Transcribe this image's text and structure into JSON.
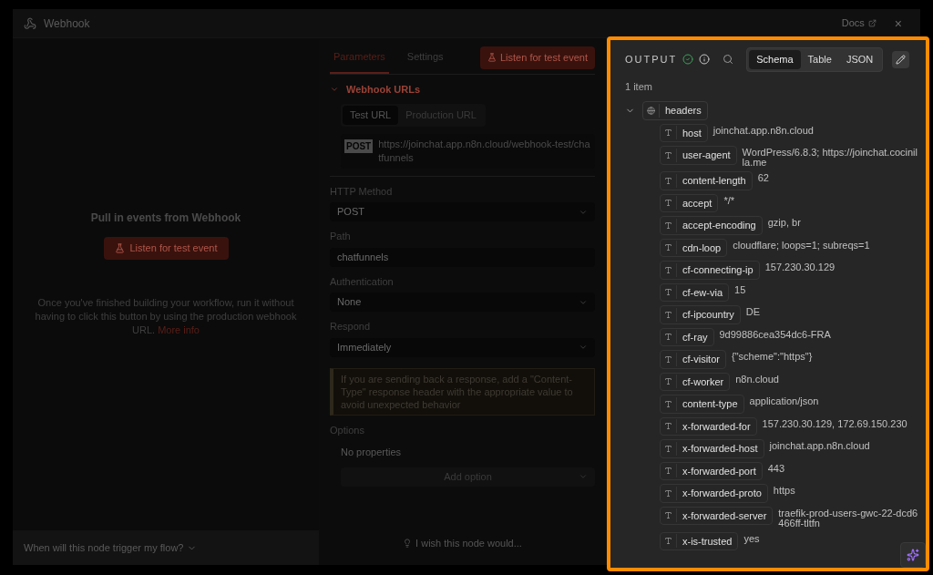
{
  "modal": {
    "title": "Webhook",
    "docs_link": "Docs",
    "close": "×"
  },
  "trigger_panel": {
    "heading": "Pull in events from Webhook",
    "listen_button": "Listen for test event",
    "description": "Once you've finished building your workflow, run it without having to click this button by using the production webhook URL.",
    "more_info_link": "More info",
    "footer": "When will this node trigger my flow?"
  },
  "parameters": {
    "tabs": [
      {
        "label": "Parameters",
        "selected": true
      },
      {
        "label": "Settings",
        "selected": false
      }
    ],
    "listen_button": "Listen for test event",
    "webhook_urls": {
      "title": "Webhook URLs",
      "expanded": true,
      "url_tabs": [
        {
          "label": "Test URL",
          "selected": true
        },
        {
          "label": "Production URL",
          "selected": false
        }
      ],
      "method_badge": "POST",
      "url": "https://joinchat.app.n8n.cloud/webhook-test/chatfunnels"
    },
    "fields": [
      {
        "label": "HTTP Method",
        "value": "POST",
        "kind": "select"
      },
      {
        "label": "Path",
        "value": "chatfunnels",
        "kind": "text"
      },
      {
        "label": "Authentication",
        "value": "None",
        "kind": "select"
      },
      {
        "label": "Respond",
        "value": "Immediately",
        "kind": "select"
      }
    ],
    "notice": "If you are sending back a response, add a \"Content-Type\" response header with the appropriate value to avoid unexpected behavior",
    "options": {
      "label": "Options",
      "empty_text": "No properties",
      "add_button": "Add option"
    },
    "feedback": "I wish this node would..."
  },
  "output": {
    "title": "OUTPUT",
    "view_tabs": [
      {
        "label": "Schema",
        "selected": true
      },
      {
        "label": "Table",
        "selected": false
      },
      {
        "label": "JSON",
        "selected": false
      }
    ],
    "count": "1 item",
    "tree": {
      "name": "headers",
      "expanded": true,
      "children": [
        {
          "key": "host",
          "value": "joinchat.app.n8n.cloud"
        },
        {
          "key": "user-agent",
          "value": "WordPress/6.8.3; https://joinchat.cocinilla.me"
        },
        {
          "key": "content-length",
          "value": "62"
        },
        {
          "key": "accept",
          "value": "*/*"
        },
        {
          "key": "accept-encoding",
          "value": "gzip, br"
        },
        {
          "key": "cdn-loop",
          "value": "cloudflare; loops=1; subreqs=1"
        },
        {
          "key": "cf-connecting-ip",
          "value": "157.230.30.129"
        },
        {
          "key": "cf-ew-via",
          "value": "15"
        },
        {
          "key": "cf-ipcountry",
          "value": "DE"
        },
        {
          "key": "cf-ray",
          "value": "9d99886cea354dc6-FRA"
        },
        {
          "key": "cf-visitor",
          "value": "{\"scheme\":\"https\"}"
        },
        {
          "key": "cf-worker",
          "value": "n8n.cloud"
        },
        {
          "key": "content-type",
          "value": "application/json"
        },
        {
          "key": "x-forwarded-for",
          "value": "157.230.30.129, 172.69.150.230"
        },
        {
          "key": "x-forwarded-host",
          "value": "joinchat.app.n8n.cloud"
        },
        {
          "key": "x-forwarded-port",
          "value": "443"
        },
        {
          "key": "x-forwarded-proto",
          "value": "https"
        },
        {
          "key": "x-forwarded-server",
          "value": "traefik-prod-users-gwc-22-dcd6466ff-tltfn"
        },
        {
          "key": "x-is-trusted",
          "value": "yes"
        }
      ]
    }
  }
}
